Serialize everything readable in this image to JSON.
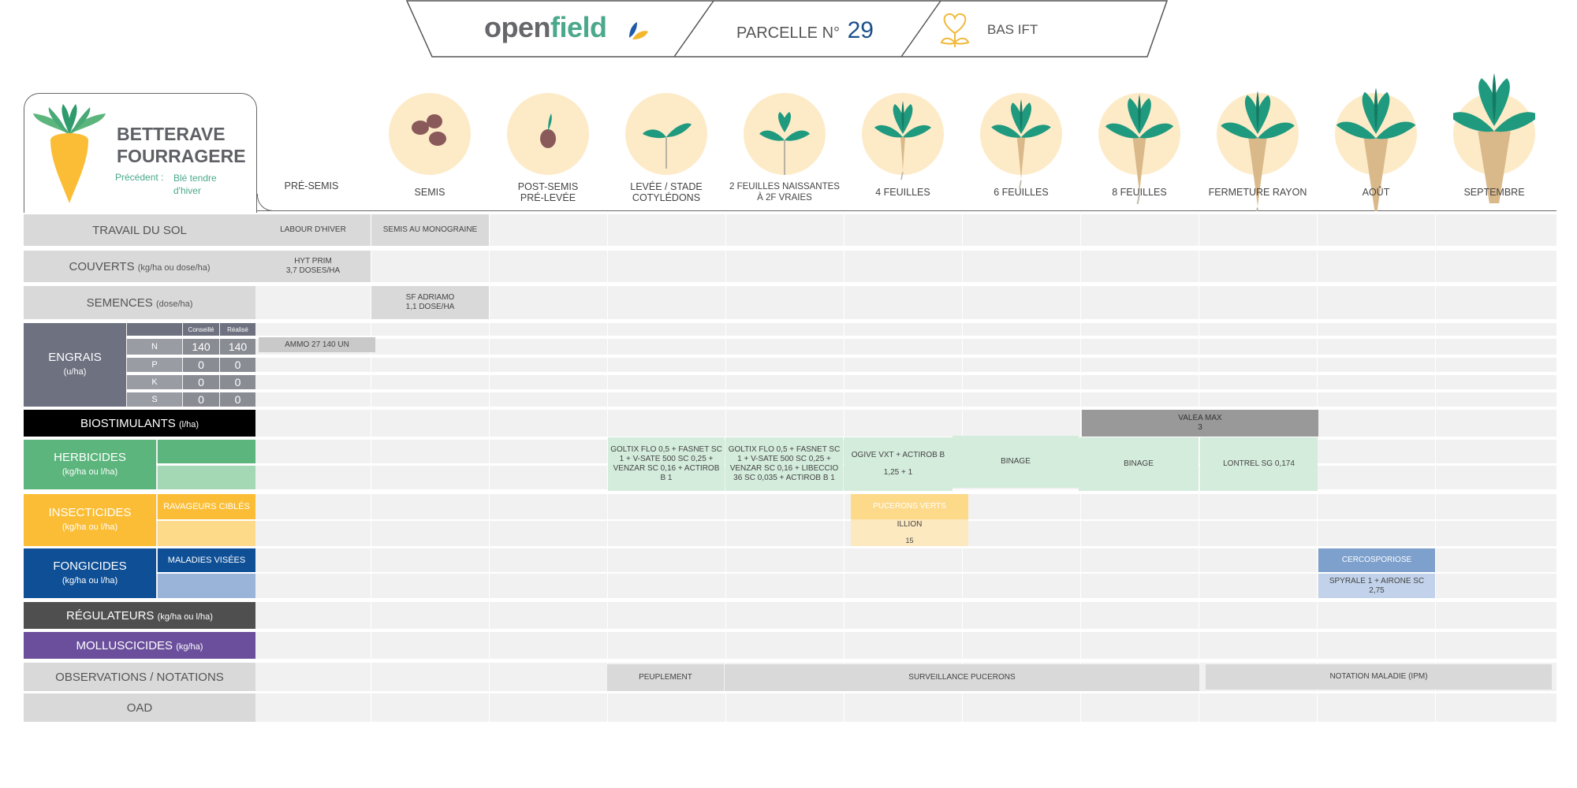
{
  "header": {
    "logo_open": "open",
    "logo_field": "field",
    "parcel_label": "PARCELLE N°",
    "parcel_number": "29",
    "ift_label": "BAS IFT"
  },
  "crop": {
    "name_line1": "BETTERAVE",
    "name_line2": "FOURRAGERE",
    "precedent_label": "Précédent :",
    "precedent_value_line1": "Blé tendre",
    "precedent_value_line2": "d'hiver"
  },
  "stages": [
    "PRÉ-SEMIS",
    "SEMIS",
    "POST-SEMIS\nPRÉ-LEVÉE",
    "LEVÉE / STADE\nCOTYLÉDONS",
    "2 FEUILLES NAISSANTES\nÀ 2F VRAIES",
    "4 FEUILLES",
    "6 FEUILLES",
    "8 FEUILLES",
    "FERMETURE RAYON",
    "AOÛT",
    "SEPTEMBRE"
  ],
  "rows": {
    "travail": "TRAVAIL DU SOL",
    "couverts": "COUVERTS",
    "couverts_unit": "(kg/ha ou dose/ha)",
    "semences": "SEMENCES",
    "semences_unit": "(dose/ha)",
    "engrais": "ENGRAIS",
    "engrais_unit": "(u/ha)",
    "biostim": "BIOSTIMULANTS",
    "biostim_unit": "(l/ha)",
    "herbicides": "HERBICIDES",
    "herbicides_unit": "(kg/ha ou l/ha)",
    "insecticides": "INSECTICIDES",
    "insecticides_unit": "(kg/ha ou l/ha)",
    "insecticides_sub": "RAVAGEURS CIBLÉS",
    "fongicides": "FONGICIDES",
    "fongicides_unit": "(kg/ha ou l/ha)",
    "fongicides_sub": "MALADIES VISÉES",
    "regulateurs": "RÉGULATEURS",
    "regulateurs_unit": "(kg/ha ou l/ha)",
    "molluscicides": "MOLLUSCICIDES",
    "molluscicides_unit": "(kg/ha)",
    "observations": "OBSERVATIONS / NOTATIONS",
    "oad": "OAD"
  },
  "engrais_table": {
    "col_conseille": "Conseillé",
    "col_realise": "Réalisé",
    "rows": [
      {
        "nutrient": "N",
        "conseille": "140",
        "realise": "140"
      },
      {
        "nutrient": "P",
        "conseille": "0",
        "realise": "0"
      },
      {
        "nutrient": "K",
        "conseille": "0",
        "realise": "0"
      },
      {
        "nutrient": "S",
        "conseille": "0",
        "realise": "0"
      }
    ]
  },
  "entries": {
    "labour": "LABOUR D'HIVER",
    "semis_mono": "SEMIS AU MONOGRAINE",
    "hyt_prim_1": "HYT PRIM",
    "hyt_prim_2": "3,7 DOSES/HA",
    "sf_adriamo_1": "SF ADRIAMO",
    "sf_adriamo_2": "1,1 DOSE/HA",
    "ammo": "AMMO 27 140 UN",
    "valea_1": "VALEA MAX",
    "valea_2": "3",
    "herb_leve": "GOLTIX FLO 0,5 + FASNET SC 1 + V-SATE 500 SC 0,25 + VENZAR SC 0,16 + ACTIROB B 1",
    "herb_2f": "GOLTIX FLO 0,5 + FASNET SC 1 + V-SATE 500 SC 0,25 + VENZAR SC 0,16 + LIBECCIO 36 SC 0,035 + ACTIROB B 1",
    "herb_4f_1": "OGIVE VXT + ACTIROB B",
    "herb_4f_2": "1,25 + 1",
    "binage_1": "BINAGE",
    "binage_2": "BINAGE",
    "lontrel": "LONTREL SG 0,174",
    "pucerons_verts": "PUCERONS VERTS",
    "illion": "ILLION",
    "illion_dose": "15",
    "cercosporiose": "CERCOSPORIOSE",
    "spyrale": "SPYRALE 1 + AIRONE SC 2,75",
    "peuplement": "PEUPLEMENT",
    "surveillance": "SURVEILLANCE PUCERONS",
    "notation": "NOTATION MALADIE (IPM)"
  },
  "colors": {
    "herbicides": "#5cb57d",
    "insecticides": "#fbbd35",
    "fongicides": "#0e4f96",
    "regulateurs": "#4f4f4f",
    "molluscicides": "#6b4f9c",
    "biostim": "#000000",
    "engrais": "#6e7180",
    "circle": "#fdebc8",
    "leaf": "#1f9a7e"
  }
}
